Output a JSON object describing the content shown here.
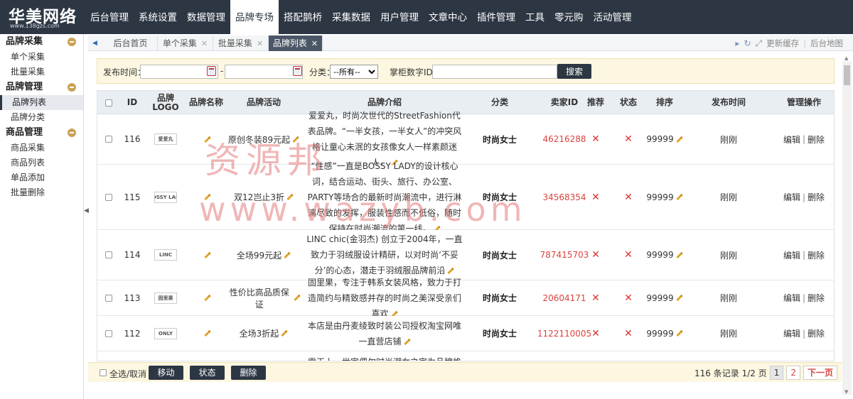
{
  "logo": {
    "name": "华美网络",
    "url": "www.138gzs.com"
  },
  "topnav": [
    "后台管理",
    "系统设置",
    "数据管理",
    "品牌专场",
    "搭配鹊桥",
    "采集数据",
    "用户管理",
    "文章中心",
    "插件管理",
    "工具",
    "零元购",
    "活动管理"
  ],
  "topnav_active": "品牌专场",
  "sidebar": {
    "groups": [
      {
        "title": "品牌采集",
        "items": [
          "单个采集",
          "批量采集"
        ]
      },
      {
        "title": "品牌管理",
        "items": [
          "品牌列表",
          "品牌分类"
        ]
      },
      {
        "title": "商品管理",
        "items": [
          "商品采集",
          "商品列表",
          "单品添加",
          "批量删除"
        ]
      }
    ],
    "active_item": "品牌列表"
  },
  "tabs": [
    {
      "label": "后台首页",
      "closable": false
    },
    {
      "label": "单个采集",
      "closable": true
    },
    {
      "label": "批量采集",
      "closable": true
    },
    {
      "label": "品牌列表",
      "closable": true,
      "active": true
    }
  ],
  "tab_tools": {
    "refresh_cache": "更新缓存",
    "sitemap": "后台地图"
  },
  "search": {
    "publish_time_label": "发布时间：",
    "range_sep": "-",
    "category_label": "分类：",
    "category_selected": "--所有--",
    "seller_label": "掌柜数字ID：",
    "button": "搜索"
  },
  "table": {
    "headers": {
      "id": "ID",
      "logo": "品牌LOGO",
      "name": "品牌名称",
      "activity": "品牌活动",
      "intro": "品牌介绍",
      "category": "分类",
      "seller": "卖家ID",
      "recommend": "推荐",
      "status": "状态",
      "sort": "排序",
      "time": "发布时间",
      "ops": "管理操作"
    },
    "rows": [
      {
        "id": "116",
        "logo_text": "爱爱丸",
        "activity": "原创冬装89元起",
        "intro": "爱爱丸，时尚次世代的StreetFashion代表品牌。“一半女孩，一半女人”的冲突风格让童心未泯的女孩像女人一样素颜迷人。",
        "category": "时尚女士",
        "seller": "46216288",
        "sort": "99999",
        "time": "刚刚"
      },
      {
        "id": "115",
        "logo_text": "BOSSY LADY",
        "activity": "双12岂止3折",
        "intro": "“性感”一直是BOSSY LADY的设计核心词，结合运动、街头、旅行、办公室、PARTY等场合的最新时尚潮流中，进行淋漓尽致的发挥，服装性感而不低俗，随时保持在时尚潮流的第一线。",
        "category": "时尚女士",
        "seller": "34568354",
        "sort": "99999",
        "time": "刚刚"
      },
      {
        "id": "114",
        "logo_text": "LINC",
        "activity": "全场99元起",
        "intro": "LINC chic(金羽杰) 创立于2004年，一直致力于羽绒服设计精研，以对时尚‘不妥分’的心态，潜走于羽绒服品牌前沿",
        "category": "时尚女士",
        "seller": "787415703",
        "sort": "99999",
        "time": "刚刚"
      },
      {
        "id": "113",
        "logo_text": "固里果",
        "activity": "性价比高品质保证",
        "intro": "固里果，专注于韩系女装风格，致力于打造简约与精致感并存的时尚之美深受亲们喜欢",
        "category": "时尚女士",
        "seller": "20604171",
        "sort": "99999",
        "time": "刚刚"
      },
      {
        "id": "112",
        "logo_text": "ONLY",
        "activity": "全场3折起",
        "intro": "本店是由丹麦绫致时装公司授权淘宝网唯一直营店铺",
        "category": "时尚女士",
        "seller": "1122110005",
        "sort": "99999",
        "time": "刚刚"
      },
      {
        "id": "",
        "logo_text": "",
        "activity": "",
        "intro": "零玉上，世家偶尔时尚潮女之家为品牌格入，提交",
        "category": "",
        "seller": "",
        "sort": "",
        "time": ""
      }
    ],
    "ops_edit": "编辑",
    "ops_sep": "|",
    "ops_delete": "删除"
  },
  "footer": {
    "select_all": "全选/取消",
    "buttons": [
      "移动",
      "状态",
      "删除"
    ],
    "records": "116 条记录 1/2 页",
    "pages": [
      "1",
      "2"
    ],
    "next": "下一页"
  },
  "watermark": {
    "line1": "资源邦",
    "line2": "www.wazyb.com"
  },
  "colors": {
    "nav_bg": "#2d3744",
    "seller": "#d9443f",
    "x_mark": "#dd3333",
    "search_bg": "#fdf7e1"
  }
}
